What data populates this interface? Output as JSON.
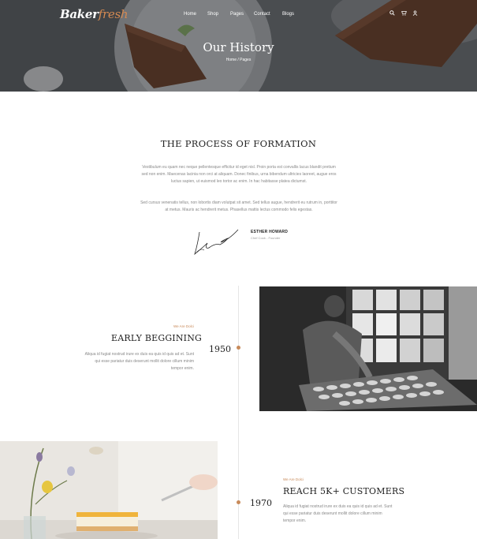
{
  "header": {
    "logo_main": "Baker",
    "logo_accent": "fresh",
    "nav": [
      "Home",
      "Shop",
      "Pages",
      "Contact",
      "Blogs"
    ],
    "icons": [
      "search-icon",
      "cart-icon",
      "user-icon"
    ]
  },
  "hero": {
    "title": "Our History",
    "breadcrumb": "Home / Pages"
  },
  "formation": {
    "title": "THE PROCESS OF FORMATION",
    "paragraph_1": "Vestibulum eu quam nec neque pellentesque efficitur id eget nisl. Proin porta est convallis lacus blandit pretium sed non enim. Maecenas lacinia non orci at aliquam. Donec finibus, urna bibendum ultricies laoreet, augue eros luctus sapien, ut euismod leo tortor ac enim. In hac habitasse platea dictumst.",
    "paragraph_2": "Sed cursus venenatis tellus, non lobortis diam volutpat sit amet. Sed tellus augue, hendrerit eu rutrum in, porttitor at metus. Mauris ac hendrerit metus. Phasellus mattis lectus commodo felis egestas.",
    "signature_name": "ESTHER HOWARD",
    "signature_role": "Chef Cook - Founder"
  },
  "timeline": [
    {
      "eyebrow": "We Are Dolci",
      "title": "EARLY BEGGINING",
      "year": "1950",
      "text": "Aliqua id fugiat nostrud irure ex duis ea quis id quis ad et. Sunt qui esse pariatur duis deserunt mollit dolore cillum minim tempor enim."
    },
    {
      "eyebrow": "We Are Dolci",
      "title": "REACH 5K+ CUSTOMERS",
      "year": "1970",
      "text": "Aliqua id fugiat nostrud irure ex duis ea quis id quis ad et. Sunt qui esse pariatur duis deserunt mollit dolore cillum minim tempor enim."
    }
  ],
  "colors": {
    "accent": "#c88a5a",
    "hero_overlay": "#5d6064",
    "title_text": "#222222",
    "body_text": "#888888"
  }
}
